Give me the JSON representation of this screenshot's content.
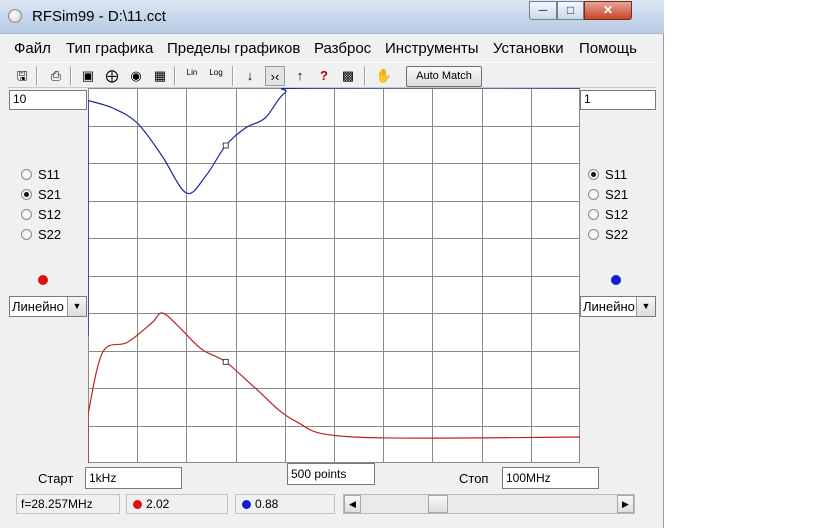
{
  "window": {
    "title": "RFSim99 - D:\\11.cct"
  },
  "menu": [
    {
      "label": "Файл"
    },
    {
      "label": "Тип графика"
    },
    {
      "label": "Пределы графиков"
    },
    {
      "label": "Разброс"
    },
    {
      "label": "Инструменты"
    },
    {
      "label": "Установки"
    },
    {
      "label": "Помощь"
    }
  ],
  "toolbar": {
    "lin_label": "Lin",
    "log_label": "Log",
    "auto_match": "Auto Match",
    "icons": [
      "save-icon",
      "print-icon",
      "rect-plot-icon",
      "smith-chart-icon",
      "polar-plot-icon",
      "table-icon",
      "lin-scale-icon",
      "log-scale-icon",
      "arrow-down-icon",
      "narrow-icon",
      "arrow-up-icon",
      "help-icon",
      "qr-icon",
      "cursor-icon"
    ]
  },
  "left_panel": {
    "top_limit": "10",
    "params": [
      "S11",
      "S21",
      "S12",
      "S22"
    ],
    "selected": "S21",
    "marker_color": "#e01010",
    "scale": "Линейно"
  },
  "right_panel": {
    "top_limit": "1",
    "params": [
      "S11",
      "S21",
      "S12",
      "S22"
    ],
    "selected": "S11",
    "marker_color": "#1020d0",
    "scale": "Линейно"
  },
  "sweep": {
    "start_label": "Старт",
    "start_value": "1kHz",
    "points": "500 points",
    "stop_label": "Стоп",
    "stop_value": "100MHz"
  },
  "status": {
    "frequency": "f=28.257MHz",
    "left_value": "2.02",
    "right_value": "0.88"
  },
  "chart_data": {
    "type": "line",
    "grid": true,
    "series": [
      {
        "color": "#1a2a9a",
        "values": [
          [
            0,
            0.95
          ],
          [
            0.5,
            0.92
          ],
          [
            1,
            0.86
          ],
          [
            1.5,
            0.73
          ],
          [
            2,
            0.58
          ],
          [
            2.4,
            0.65
          ],
          [
            2.8,
            0.77
          ],
          [
            3.2,
            0.84
          ],
          [
            3.6,
            0.88
          ],
          [
            4,
            0.98
          ],
          [
            4.5,
            1.0
          ],
          [
            10,
            1.0
          ]
        ]
      },
      {
        "color": "#c02020",
        "values": [
          [
            0,
            0.14
          ],
          [
            0.3,
            0.52
          ],
          [
            0.8,
            0.58
          ],
          [
            1.3,
            0.7
          ],
          [
            1.5,
            0.76
          ],
          [
            1.8,
            0.69
          ],
          [
            2.3,
            0.54
          ],
          [
            2.8,
            0.46
          ],
          [
            3.4,
            0.3
          ],
          [
            4.2,
            0.1
          ],
          [
            5.4,
            0.0
          ],
          [
            10,
            0.0
          ]
        ]
      }
    ]
  }
}
